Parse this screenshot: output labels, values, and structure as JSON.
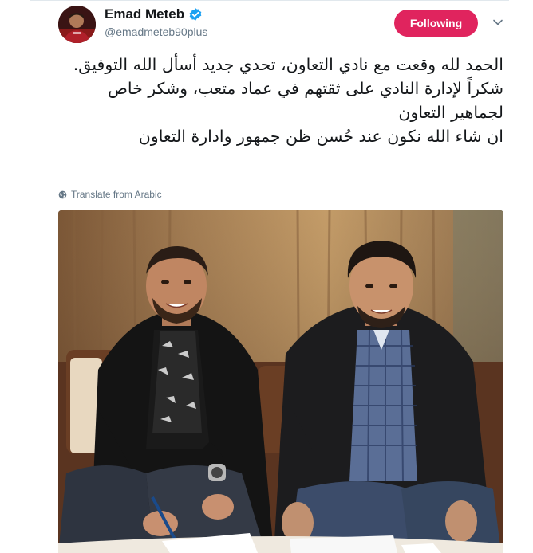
{
  "tweet": {
    "author": {
      "display_name": "Emad Meteb",
      "handle": "@emadmeteb90plus",
      "verified": true,
      "avatar_icon": "profile-avatar"
    },
    "follow_button_label": "Following",
    "menu_icon": "chevron-down-icon",
    "text_lines": [
      "الحمد لله وقعت مع نادي التعاون، تحدي جديد أسأل الله التوفيق.",
      "شكراً لإدارة النادي على ثقتهم في عماد متعب، وشكر خاص لجماهير التعاون",
      "ان شاء الله نكون عند حُسن ظن جمهور وادارة التعاون"
    ],
    "translate_label": "Translate from Arabic",
    "translate_icon": "globe-icon",
    "media": {
      "type": "photo",
      "description_icon": "contract-signing-photo"
    }
  },
  "colors": {
    "follow_button_bg": "#e0245e",
    "verified_blue": "#1da1f2",
    "secondary_text": "#657786",
    "primary_text": "#14171a"
  }
}
